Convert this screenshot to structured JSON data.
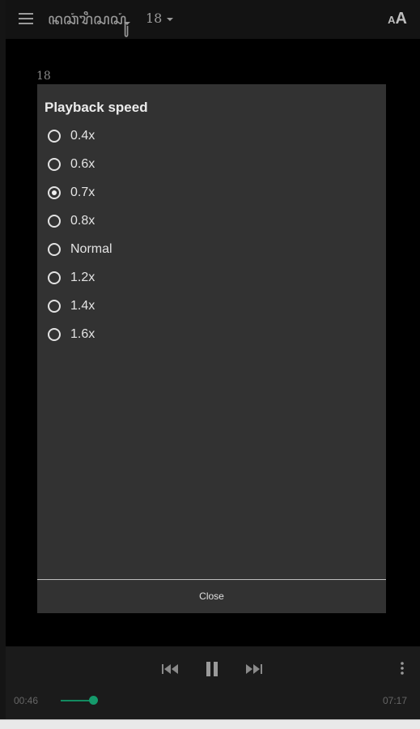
{
  "header": {
    "book_title": "ꦤꦕꦁꦫꦶꦱꦱꦸꦁ",
    "chapter": "18"
  },
  "content": {
    "verse_number": "18"
  },
  "dialog": {
    "title": "Playback speed",
    "options": [
      {
        "label": "0.4x",
        "selected": false
      },
      {
        "label": "0.6x",
        "selected": false
      },
      {
        "label": "0.7x",
        "selected": true
      },
      {
        "label": "0.8x",
        "selected": false
      },
      {
        "label": "Normal",
        "selected": false
      },
      {
        "label": "1.2x",
        "selected": false
      },
      {
        "label": "1.4x",
        "selected": false
      },
      {
        "label": "1.6x",
        "selected": false
      }
    ],
    "close_label": "Close"
  },
  "player": {
    "elapsed": "00:46",
    "total": "07:17",
    "progress": 0.105,
    "accent_color": "#159a6b"
  },
  "icons": {
    "menu": "menu-icon",
    "text_size": "text-size-icon",
    "previous": "skip-previous-icon",
    "pause": "pause-icon",
    "next": "skip-next-icon",
    "more": "more-vertical-icon"
  }
}
